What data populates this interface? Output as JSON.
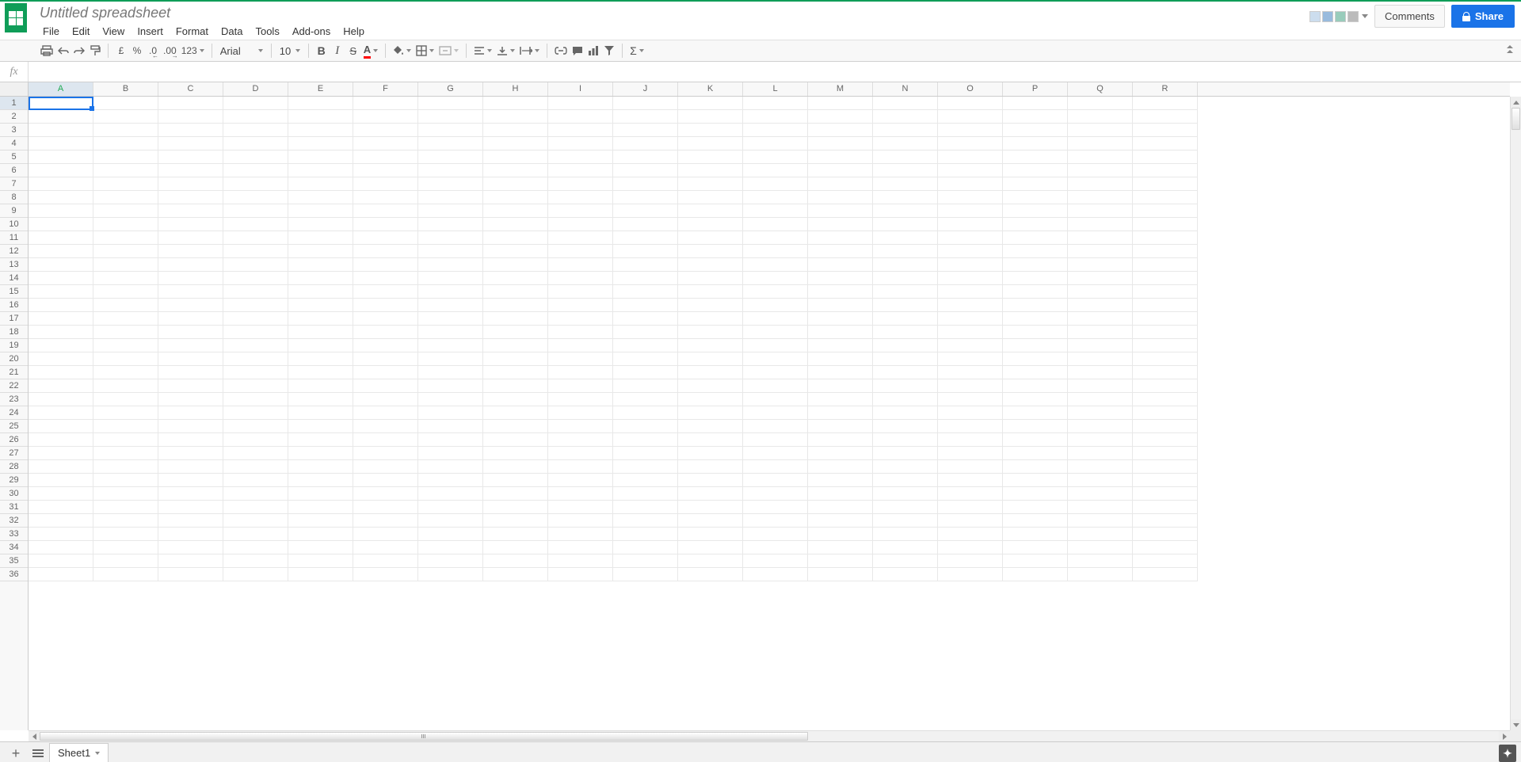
{
  "header": {
    "title": "Untitled spreadsheet",
    "comments_label": "Comments",
    "share_label": "Share"
  },
  "menu": {
    "items": [
      "File",
      "Edit",
      "View",
      "Insert",
      "Format",
      "Data",
      "Tools",
      "Add-ons",
      "Help"
    ]
  },
  "toolbar": {
    "currency_symbol": "£",
    "percent_symbol": "%",
    "decrease_dec": ".0",
    "increase_dec": ".00",
    "more_formats": "123",
    "font_name": "Arial",
    "font_size": "10",
    "bold": "B",
    "italic": "I",
    "strike": "S",
    "textcolor": "A",
    "functions": "Σ"
  },
  "formula_bar": {
    "fx": "fx",
    "value": ""
  },
  "grid": {
    "columns": [
      "A",
      "B",
      "C",
      "D",
      "E",
      "F",
      "G",
      "H",
      "I",
      "J",
      "K",
      "L",
      "M",
      "N",
      "O",
      "P",
      "Q",
      "R"
    ],
    "rows": [
      1,
      2,
      3,
      4,
      5,
      6,
      7,
      8,
      9,
      10,
      11,
      12,
      13,
      14,
      15,
      16,
      17,
      18,
      19,
      20,
      21,
      22,
      23,
      24,
      25,
      26,
      27,
      28,
      29,
      30,
      31,
      32,
      33,
      34,
      35,
      36
    ],
    "selected_cell": "A1"
  },
  "sheet_bar": {
    "active_tab": "Sheet1"
  },
  "colors": {
    "brand_green": "#0f9d58",
    "share_blue": "#1a73e8",
    "text_color_underline": "#ff0000"
  }
}
